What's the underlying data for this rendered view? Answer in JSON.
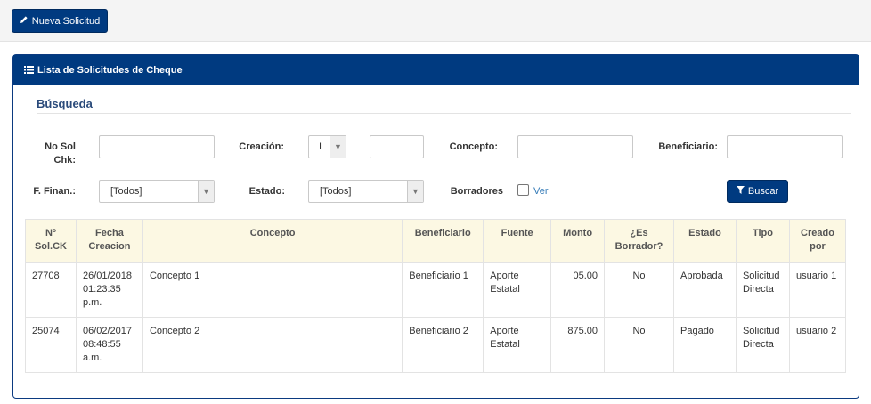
{
  "toolbar": {
    "new_button_label": "Nueva Solicitud",
    "new_button_icon": "pencil-icon"
  },
  "panel": {
    "title": "Lista de Solicitudes de Cheque",
    "title_icon": "list-icon"
  },
  "search": {
    "title": "Búsqueda",
    "no_sol_label_1": "No Sol",
    "no_sol_label_2": "Chk:",
    "no_sol_value": "",
    "creacion_label": "Creación:",
    "creacion_select_value": "I",
    "creacion_value": "",
    "concepto_label": "Concepto:",
    "concepto_value": "",
    "beneficiario_label": "Beneficiario:",
    "beneficiario_value": "",
    "finan_label": "F. Finan.:",
    "finan_value": "[Todos]",
    "estado_label": "Estado:",
    "estado_value": "[Todos]",
    "borradores_label": "Borradores",
    "ver_label": "Ver",
    "search_button_label": "Buscar",
    "search_button_icon": "filter-icon"
  },
  "table": {
    "headers": [
      [
        "Nº",
        "Sol.CK"
      ],
      [
        "Fecha",
        "Creacion"
      ],
      [
        "Concepto"
      ],
      [
        "Beneficiario"
      ],
      [
        "Fuente"
      ],
      [
        "Monto"
      ],
      [
        "¿Es",
        "Borrador?"
      ],
      [
        "Estado"
      ],
      [
        "Tipo"
      ],
      [
        "Creado",
        "por"
      ]
    ],
    "rows": [
      {
        "no": "27708",
        "fecha": [
          "26/01/2018",
          "01:23:35",
          "p.m."
        ],
        "concepto": "Concepto 1",
        "beneficiario": "Beneficiario 1",
        "fuente": [
          "Aporte",
          "Estatal"
        ],
        "monto": "05.00",
        "borrador": "No",
        "estado": "Aprobada",
        "tipo": [
          "Solicitud",
          "Directa"
        ],
        "creado": "usuario 1"
      },
      {
        "no": "25074",
        "fecha": [
          "06/02/2017",
          "08:48:55",
          "a.m."
        ],
        "concepto": "Concepto 2",
        "beneficiario": "Beneficiario 2",
        "fuente": [
          "Aporte",
          "Estatal"
        ],
        "monto": "875.00",
        "borrador": "No",
        "estado": "Pagado",
        "tipo": [
          "Solicitud",
          "Directa"
        ],
        "creado": "usuario 2"
      }
    ]
  },
  "colors": {
    "primary": "#003a80",
    "table_header_bg": "#fcf8e3",
    "link": "#337ab7"
  }
}
